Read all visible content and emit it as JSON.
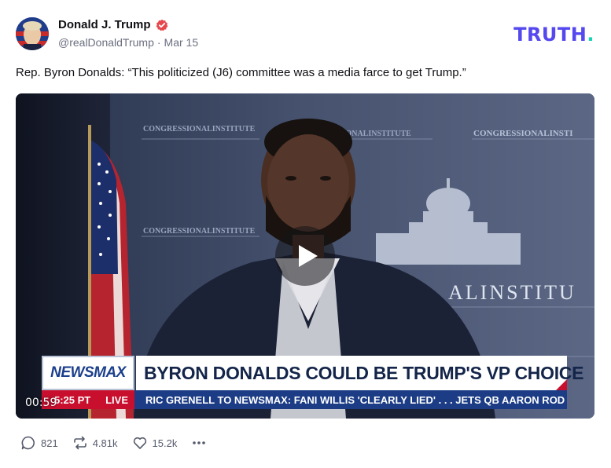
{
  "author": {
    "display_name": "Donald J. Trump",
    "handle": "@realDonaldTrump",
    "separator": "·",
    "date": "Mar 15"
  },
  "brand": {
    "logo_text": "TRUTH",
    "logo_dot": ".",
    "primary_color": "#5448ee",
    "dot_color": "#15d4b2"
  },
  "post": {
    "text": "Rep. Byron Donalds: “This politicized (J6) committee was a media farce to get Trump.”"
  },
  "video": {
    "duration": "00:59",
    "overlay": {
      "network_logo": "NEWSMAX",
      "headline": "BYRON DONALDS COULD BE TRUMP'S VP CHOICE",
      "time": "5:25 PT",
      "live": "LIVE",
      "ticker": "RIC GRENELL TO NEWSMAX: FANI WILLIS 'CLEARLY LIED' . . .    JETS QB AARON ROD"
    },
    "backdrop": {
      "banner_1": "CONGRESSIONALINSTITUTE",
      "banner_2": "ALINSTITUT"
    }
  },
  "actions": {
    "replies": "821",
    "retruths": "4.81k",
    "likes": "15.2k",
    "more": "•••"
  }
}
